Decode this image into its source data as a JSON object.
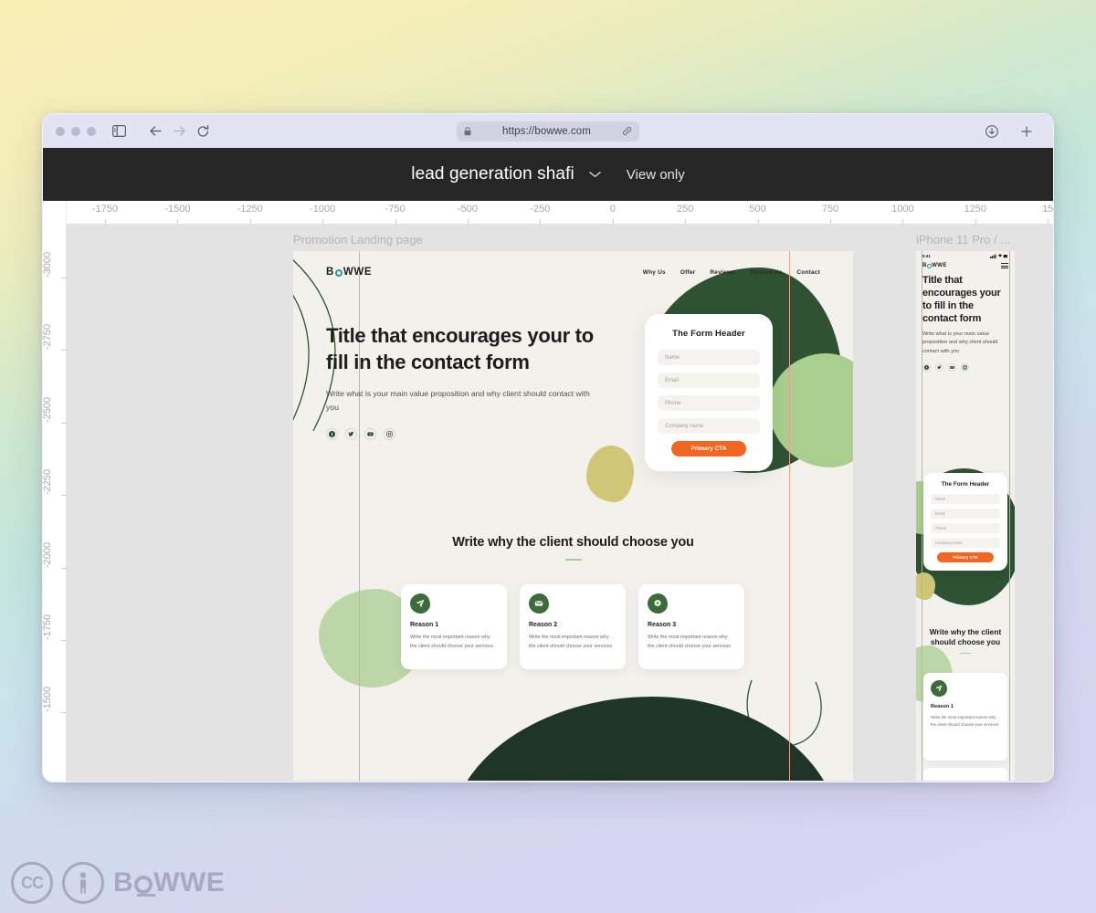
{
  "browser": {
    "url": "https://bowwe.com",
    "lock_icon": "lock-icon",
    "link_icon": "link-icon",
    "back_icon": "back-arrow-icon",
    "forward_icon": "forward-arrow-icon",
    "reload_icon": "reload-icon",
    "sidebar_icon": "sidebar-toggle-icon",
    "download_icon": "download-icon",
    "new_tab_icon": "plus-icon"
  },
  "app_header": {
    "project_title": "lead generation shafi",
    "chevron_icon": "chevron-down-icon",
    "view_mode": "View only"
  },
  "rulers": {
    "horizontal": [
      "-1750",
      "-1500",
      "-1250",
      "-1000",
      "-750",
      "-500",
      "-250",
      "0",
      "250",
      "500",
      "750",
      "1000",
      "1250",
      "15"
    ],
    "vertical": [
      "-3000",
      "-2750",
      "-2500",
      "-2250",
      "-2000",
      "-1750",
      "-1500"
    ]
  },
  "canvas": {
    "frames": [
      {
        "label": "Promotion Landing page"
      },
      {
        "label": "iPhone 11 Pro / ..."
      }
    ]
  },
  "site": {
    "logo": {
      "before": "B",
      "after": "WWE",
      "accent": "#1f9e85"
    },
    "nav": [
      "Why Us",
      "Offer",
      "Reviews",
      "Trusted Us",
      "Contact"
    ],
    "hero": {
      "title": "Title that encourages your to fill in the contact form",
      "subtitle": "Write what is your main value proposition and why client should contact with you",
      "socials": [
        "facebook-icon",
        "twitter-icon",
        "youtube-icon",
        "instagram-icon"
      ]
    },
    "form": {
      "header": "The Form Header",
      "fields": [
        {
          "placeholder": "Name"
        },
        {
          "placeholder": "Email"
        },
        {
          "placeholder": "Phone"
        },
        {
          "placeholder": "Company name"
        }
      ],
      "cta_label": "Primary CTA",
      "cta_color": "#f26522"
    },
    "reasons_section": {
      "heading": "Write why the client should choose you",
      "cards": [
        {
          "icon": "send-icon",
          "title": "Reason 1",
          "body": "Write the most important reason why the client should choose your services"
        },
        {
          "icon": "mail-icon",
          "title": "Reason 2",
          "body": "Write the most important reason why the client should choose your services"
        },
        {
          "icon": "gear-icon",
          "title": "Reason 3",
          "body": "Write the most important reason why the client should choose your services"
        }
      ]
    }
  },
  "mobile": {
    "status_time": "9:41",
    "status_right": "signal-wifi-battery-icon",
    "menu_icon": "hamburger-menu-icon",
    "hero": {
      "title": "Title that encourages your to fill in the contact form",
      "subtitle": "Write what is your main value proposition and why client should contact with you"
    },
    "form": {
      "header": "The Form Header",
      "fields": [
        {
          "placeholder": "Name"
        },
        {
          "placeholder": "Email"
        },
        {
          "placeholder": "Phone"
        },
        {
          "placeholder": "Company name"
        }
      ],
      "cta_label": "Primary CTA"
    },
    "reasons_section": {
      "heading": "Write why the client should choose you",
      "card": {
        "icon": "send-icon",
        "title": "Reason 1",
        "body": "Write the most important reason why the client should choose your services"
      }
    }
  },
  "footer": {
    "cc_label": "CC",
    "person_icon": "person-icon",
    "wordmark_before": "B",
    "wordmark_after": "WWE"
  },
  "theme": {
    "dark_header": "#262626",
    "artboard_bg": "#f2f1ec",
    "dark_green": "#2f5233",
    "deep_green": "#1e3528",
    "light_green": "#a8cf8e",
    "pale_green": "#bcd6a8",
    "olive": "#cfc678",
    "orange": "#f26522",
    "guide_pink": "#e8a291"
  }
}
